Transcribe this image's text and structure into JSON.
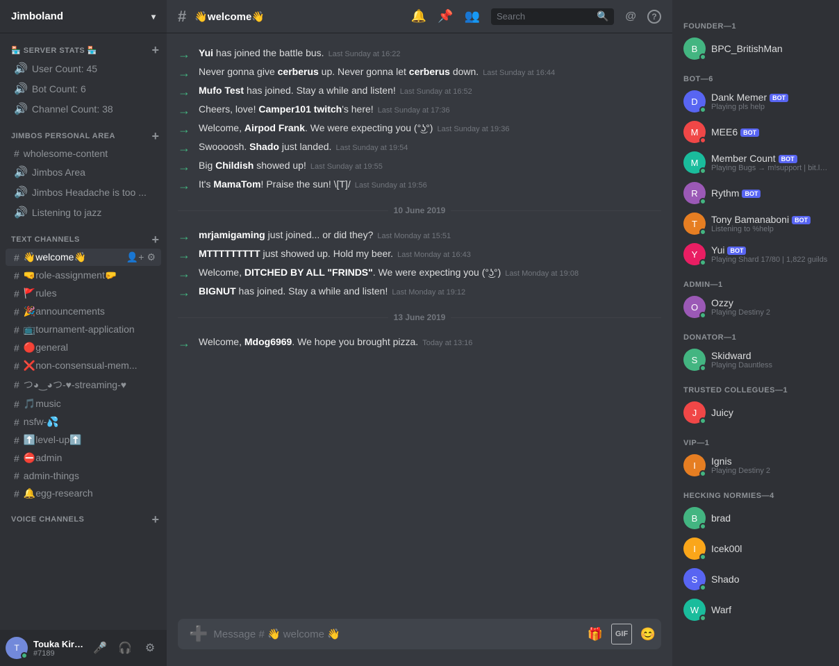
{
  "server": {
    "name": "Jimboland",
    "chevron": "▾"
  },
  "sidebar": {
    "sections": [
      {
        "id": "server-stats",
        "label": "🏪 SERVER STATS 🏪",
        "type": "voice",
        "channels": [
          {
            "icon": "🔊",
            "name": "User Count: 45"
          },
          {
            "icon": "🔊",
            "name": "Bot Count: 6"
          },
          {
            "icon": "🔊",
            "name": "Channel Count: 38"
          }
        ]
      },
      {
        "id": "jimbos-personal",
        "label": "JIMBOS PERSONAL AREA",
        "type": "text",
        "channels": [
          {
            "name": "wholesome-content"
          },
          {
            "name": "Jimbos Area",
            "type": "voice"
          },
          {
            "name": "Jimbos Headache is too ...",
            "type": "voice"
          },
          {
            "name": "Listening to jazz",
            "type": "voice"
          }
        ]
      },
      {
        "id": "text-channels",
        "label": "TEXT CHANNELS",
        "type": "text",
        "channels": [
          {
            "name": "👋welcome👋",
            "active": true,
            "emoji": "👋"
          },
          {
            "name": "🤜role-assignment🤛"
          },
          {
            "name": "🚩rules"
          },
          {
            "name": "🎉announcements"
          },
          {
            "name": "📺tournament-application"
          },
          {
            "name": "🔴general"
          },
          {
            "name": "❌non-consensual-mem..."
          },
          {
            "name": "つ◕‿◕つ-♥-streaming-♥"
          },
          {
            "name": "🎵music"
          },
          {
            "name": "nsfw-💦"
          },
          {
            "name": "⬆️level-up⬆️"
          },
          {
            "name": "⛔admin"
          },
          {
            "name": "admin-things"
          },
          {
            "name": "🔔egg-research"
          }
        ]
      }
    ],
    "voice_section_label": "VOICE CHANNELS"
  },
  "channel": {
    "name": "👋welcome👋",
    "hash": "#"
  },
  "header_icons": {
    "bell": "🔔",
    "pin": "📌",
    "members": "👥",
    "search_placeholder": "Search",
    "mention": "@",
    "help": "?"
  },
  "messages": [
    {
      "id": 1,
      "content_html": "<span class='bold'>Yui</span> has joined the battle bus.",
      "timestamp": "Last Sunday at 16:22"
    },
    {
      "id": 2,
      "content_html": "Never gonna give <span class='bold'>cerberus</span> up. Never gonna let <span class='bold'>cerberus</span> down.",
      "timestamp": "Last Sunday at 16:44"
    },
    {
      "id": 3,
      "content_html": "<span class='bold'>Mufo Test</span> has joined. Stay a while and listen!",
      "timestamp": "Last Sunday at 16:52"
    },
    {
      "id": 4,
      "content_html": "Cheers, love! <span class='bold'>Camper101 twitch</span>'s here!",
      "timestamp": "Last Sunday at 17:36"
    },
    {
      "id": 5,
      "content_html": "Welcome, <span class='bold'>Airpod Frank</span>. We were expecting you (°͜ʖ°)",
      "timestamp": "Last Sunday at 19:36"
    },
    {
      "id": 6,
      "content_html": "Swoooosh. <span class='bold'>Shado</span> just landed.",
      "timestamp": "Last Sunday at 19:54"
    },
    {
      "id": 7,
      "content_html": "Big <span class='bold'>Childish</span> showed up!",
      "timestamp": "Last Sunday at 19:55"
    },
    {
      "id": 8,
      "content_html": "It's <span class='bold'>MamaTom</span>! Praise the sun! \\[T]/",
      "timestamp": "Last Sunday at 19:56"
    },
    {
      "separator": "10 June 2019"
    },
    {
      "id": 9,
      "content_html": "<span class='bold'>mrjamigaming</span> just joined... or did they?",
      "timestamp": "Last Monday at 15:51"
    },
    {
      "id": 10,
      "content_html": "<span class='bold'>MTTTTTTTTT</span> just showed up. Hold my beer.",
      "timestamp": "Last Monday at 16:43"
    },
    {
      "id": 11,
      "content_html": "Welcome, <span class='bold'>DITCHED BY ALL \"FRINDS\"</span>. We were expecting you (°͜ʖ°)",
      "timestamp": "Last Monday at 19:08"
    },
    {
      "id": 12,
      "content_html": "<span class='bold'>BIGNUT</span> has joined. Stay a while and listen!",
      "timestamp": "Last Monday at 19:12"
    },
    {
      "separator": "13 June 2019"
    },
    {
      "id": 13,
      "content_html": "Welcome, <span class='bold'>Mdog6969</span>. We hope you brought pizza.",
      "timestamp": "Today at 13:16"
    }
  ],
  "message_input": {
    "placeholder": "Message # 👋 welcome 👋"
  },
  "members": {
    "roles": [
      {
        "label": "FOUNDER—1",
        "members": [
          {
            "name": "BPC_BritishMan",
            "avatar_color": "av-green",
            "avatar_text": "B",
            "status": "online",
            "activity": null,
            "bot": false
          }
        ]
      },
      {
        "label": "BOT—6",
        "members": [
          {
            "name": "Dank Memer",
            "avatar_color": "av-blue",
            "avatar_text": "D",
            "status": "online",
            "activity": "Playing pls help",
            "bot": true
          },
          {
            "name": "MEE6",
            "avatar_color": "av-red",
            "avatar_text": "M",
            "status": "dnd",
            "activity": null,
            "bot": true
          },
          {
            "name": "Member Count",
            "avatar_color": "av-teal",
            "avatar_text": "M",
            "status": "online",
            "activity": "Playing Bugs → m!support | bit.ly/...",
            "bot": true
          },
          {
            "name": "Rythm",
            "avatar_color": "av-purple",
            "avatar_text": "R",
            "status": "online",
            "activity": null,
            "bot": true
          },
          {
            "name": "Tony Bamanaboni",
            "avatar_color": "av-orange",
            "avatar_text": "T",
            "status": "online",
            "activity": "Listening to %help",
            "bot": true
          },
          {
            "name": "Yui",
            "avatar_color": "av-pink",
            "avatar_text": "Y",
            "status": "online",
            "activity": "Playing Shard 17/80 | 1,822 guilds",
            "bot": true
          }
        ]
      },
      {
        "label": "ADMIN—1",
        "members": [
          {
            "name": "Ozzy",
            "avatar_color": "av-purple",
            "avatar_text": "O",
            "status": "online",
            "activity": "Playing Destiny 2",
            "bot": false
          }
        ]
      },
      {
        "label": "DONATOR—1",
        "members": [
          {
            "name": "Skidward",
            "avatar_color": "av-green",
            "avatar_text": "S",
            "status": "online",
            "activity": "Playing Dauntless",
            "bot": false
          }
        ]
      },
      {
        "label": "TRUSTED COLLEGUES—1",
        "members": [
          {
            "name": "Juicy",
            "avatar_color": "av-red",
            "avatar_text": "J",
            "status": "online",
            "activity": null,
            "bot": false
          }
        ]
      },
      {
        "label": "VIP—1",
        "members": [
          {
            "name": "Ignis",
            "avatar_color": "av-orange",
            "avatar_text": "I",
            "status": "online",
            "activity": "Playing Destiny 2",
            "bot": false
          }
        ]
      },
      {
        "label": "HECKING NORMIES—4",
        "members": [
          {
            "name": "brad",
            "avatar_color": "av-green",
            "avatar_text": "B",
            "status": "online",
            "activity": null,
            "bot": false
          },
          {
            "name": "Icek00l",
            "avatar_color": "av-yellow",
            "avatar_text": "I",
            "status": "online",
            "activity": null,
            "bot": false
          },
          {
            "name": "Shado",
            "avatar_color": "av-blue",
            "avatar_text": "S",
            "status": "online",
            "activity": null,
            "bot": false
          },
          {
            "name": "Warf",
            "avatar_color": "av-teal",
            "avatar_text": "W",
            "status": "online",
            "activity": null,
            "bot": false
          }
        ]
      }
    ]
  },
  "user": {
    "name": "Touka Kirish...",
    "discriminator": "#7189",
    "avatar_color": "av-purple",
    "avatar_text": "T"
  }
}
